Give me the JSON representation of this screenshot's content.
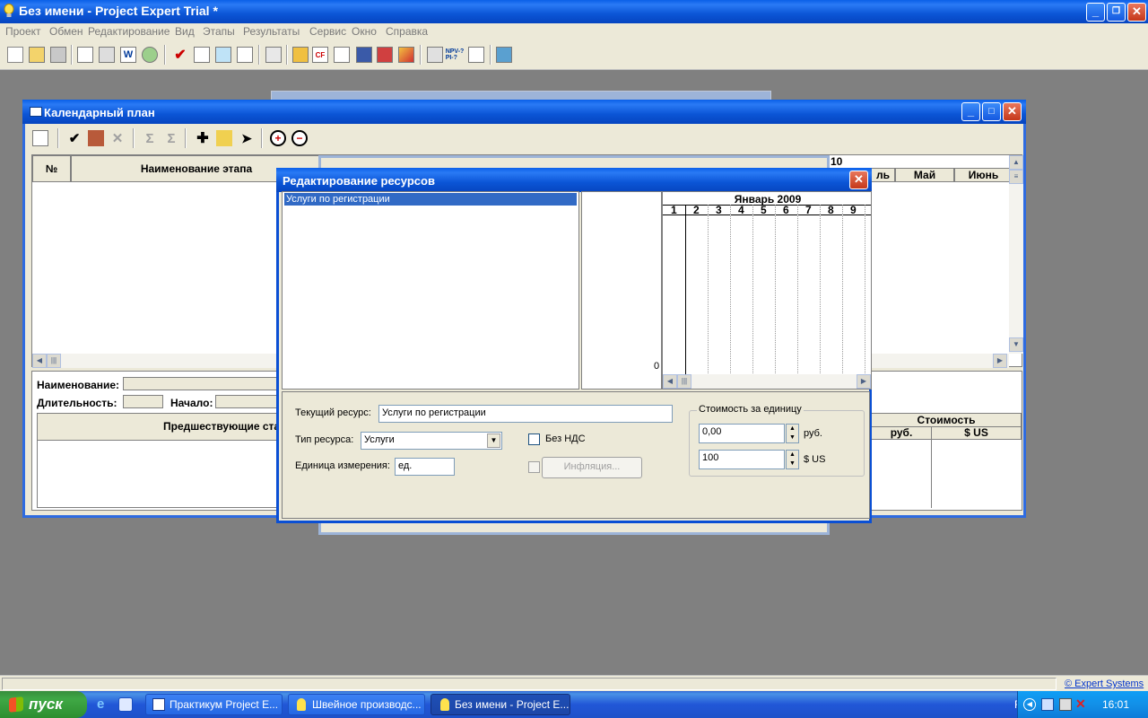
{
  "app": {
    "title": "Без имени - Project Expert Trial *",
    "menu": [
      "Проект",
      "Обмен",
      "Редактирование",
      "Вид",
      "Этапы",
      "Результаты",
      "Сервис",
      "Окно",
      "Справка"
    ]
  },
  "calendar": {
    "title": "Календарный план",
    "col_num": "№",
    "col_name": "Наименование этапа",
    "year_label": "10",
    "months": [
      "ль",
      "Май",
      "Июнь"
    ],
    "lbl_name": "Наименование:",
    "lbl_duration": "Длительность:",
    "lbl_start": "Начало:",
    "lbl_predecessors": "Предшествующие ста",
    "cost_header": "Стоимость",
    "cost_rub": "руб.",
    "cost_usd": "$ US"
  },
  "dialog": {
    "title": "Редактирование ресурсов",
    "resources": [
      "Услуги по регистрации"
    ],
    "chart_zero": "0",
    "month_label": "Январь 2009",
    "days": [
      "1",
      "2",
      "3",
      "4",
      "5",
      "6",
      "7",
      "8",
      "9"
    ],
    "lbl_current": "Текущий ресурс:",
    "current_value": "Услуги по регистрации",
    "lbl_type": "Тип ресурса:",
    "type_value": "Услуги",
    "lbl_unit": "Единица измерения:",
    "unit_value": "ед.",
    "vat_label": "Без НДС",
    "inflation_label": "Инфляция...",
    "cost_group": "Стоимость за единицу",
    "rub_value": "0,00",
    "rub_label": "руб.",
    "usd_value": "100",
    "usd_label": "$ US"
  },
  "status": {
    "link": "© Expert Systems"
  },
  "taskbar": {
    "start": "пуск",
    "tasks": [
      "Практикум Project E...",
      "Швейное производс...",
      "Без имени - Project E..."
    ],
    "lang": "RU",
    "clock": "16:01"
  },
  "colors": {
    "accent": "#0a5fe8",
    "selection": "#316ac5",
    "desktop": "#808080"
  }
}
